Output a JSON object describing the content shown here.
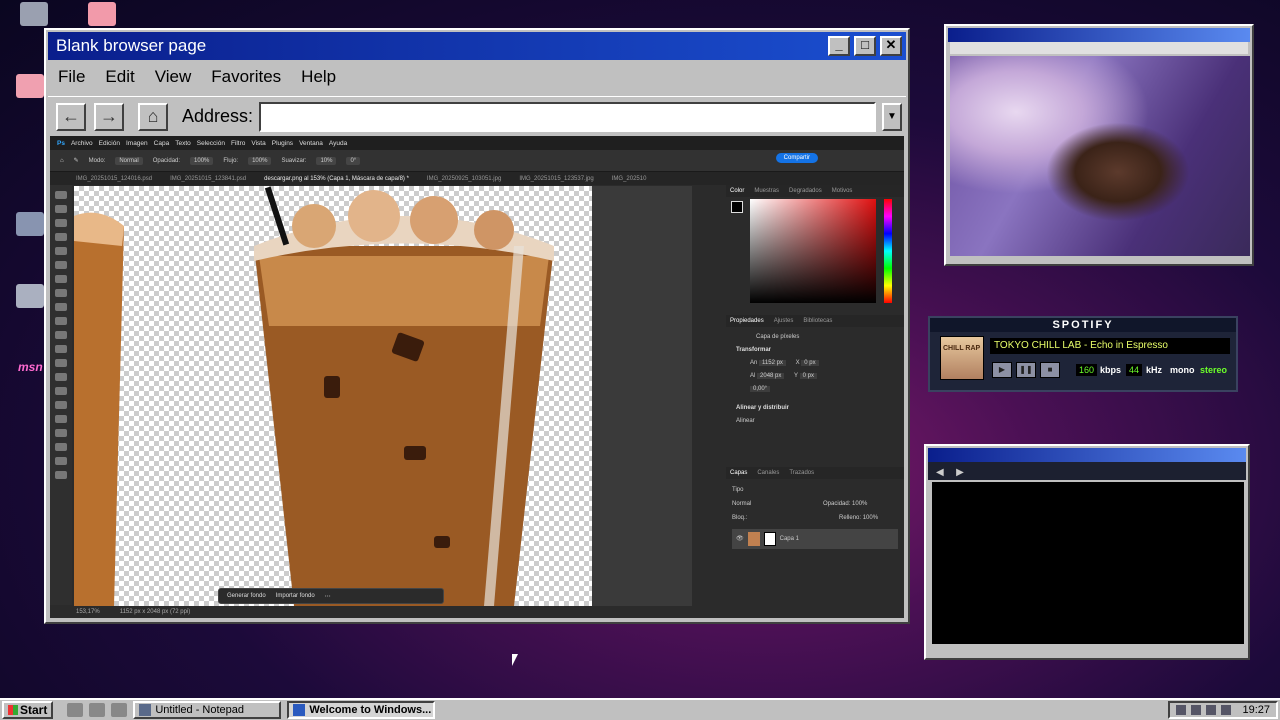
{
  "browser": {
    "title": "Blank browser page",
    "menu": [
      "File",
      "Edit",
      "View",
      "Favorites",
      "Help"
    ],
    "address_label": "Address:",
    "address_value": ""
  },
  "photoshop": {
    "menu": [
      "Archivo",
      "Edición",
      "Imagen",
      "Capa",
      "Texto",
      "Selección",
      "Filtro",
      "Vista",
      "Plugins",
      "Ventana",
      "Ayuda"
    ],
    "options": {
      "mode_label": "Modo:",
      "mode_value": "Normal",
      "opacity_label": "Opacidad:",
      "opacity_value": "100%",
      "flow_label": "Flujo:",
      "flow_value": "100%",
      "smooth_label": "Suavizar:",
      "smooth_value": "10%",
      "angle_value": "0°"
    },
    "share_label": "Compartir",
    "tabs": [
      "IMG_20251015_124016.psd",
      "IMG_20251015_123841.psd",
      "descargar.png al 153% (Capa 1, Máscara de capa/8) *",
      "IMG_20250925_103051.jpg",
      "IMG_20251015_123537.jpg",
      "IMG_202510"
    ],
    "context_bar": {
      "generate": "Generar fondo",
      "import": "Importar fondo"
    },
    "status": {
      "zoom": "153,17%",
      "size": "1152 px x 2048 px (72 ppi)"
    },
    "color_tabs": [
      "Color",
      "Muestras",
      "Degradados",
      "Motivos"
    ],
    "props_tabs": [
      "Propiedades",
      "Ajustes",
      "Bibliotecas"
    ],
    "props": {
      "type": "Capa de píxeles",
      "transform": "Transformar",
      "w_label": "An",
      "w": "1152 px",
      "h_label": "Al",
      "h": "2048 px",
      "x_label": "X",
      "x": "0 px",
      "y_label": "Y",
      "y": "0 px",
      "angle": "0,00°",
      "align": "Alinear y distribuir",
      "align_sub": "Alinear"
    },
    "layers_tabs": [
      "Capas",
      "Canales",
      "Trazados"
    ],
    "layers": {
      "filter": "Tipo",
      "blend": "Normal",
      "opacity_label": "Opacidad:",
      "opacity": "100%",
      "lock_label": "Bloq.:",
      "fill_label": "Relleno:",
      "fill": "100%",
      "layer_name": "Capa 1"
    }
  },
  "spotify": {
    "header": "SPOTIFY",
    "track": "TOKYO CHILL LAB - Echo in Espresso",
    "art_text": "CHILL RAP",
    "kbps": "160",
    "kbps_label": "kbps",
    "khz": "44",
    "khz_label": "kHz",
    "mono": "mono",
    "stereo": "stereo"
  },
  "taskbar": {
    "start": "Start",
    "tasks": [
      "Untitled - Notepad",
      "Welcome to Windows..."
    ],
    "clock": "19:27"
  },
  "desktop": {
    "msn_label": "msn"
  }
}
